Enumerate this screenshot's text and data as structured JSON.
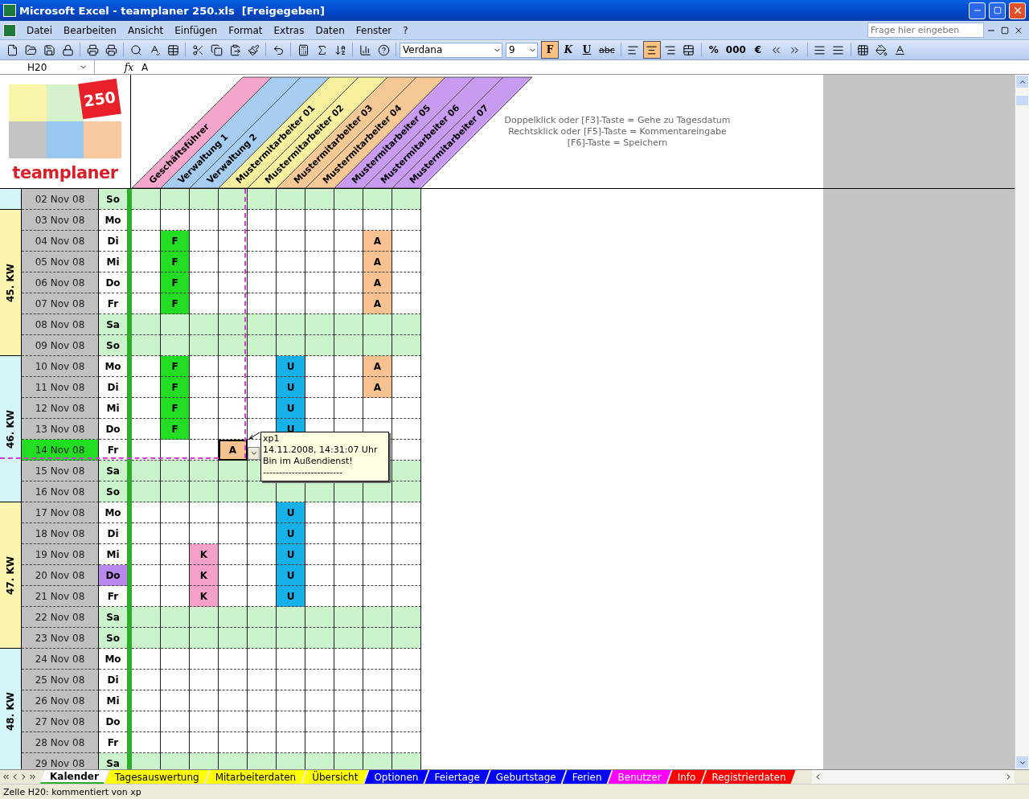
{
  "window": {
    "title": "Microsoft Excel - teamplaner 250.xls  [Freigegeben]"
  },
  "menu": [
    "Datei",
    "Bearbeiten",
    "Ansicht",
    "Einfügen",
    "Format",
    "Extras",
    "Daten",
    "Fenster",
    "?"
  ],
  "help_field": {
    "placeholder": "Frage hier eingeben"
  },
  "formatting": {
    "font": "Verdana",
    "size": "9",
    "styles": [
      {
        "label": "F",
        "kind": "bold",
        "pressed": true
      },
      {
        "label": "K",
        "kind": "italic",
        "pressed": false
      },
      {
        "label": "U",
        "kind": "underline",
        "pressed": false
      },
      {
        "label": "abc",
        "kind": "strike",
        "pressed": false
      }
    ],
    "alignment": [
      {
        "selected": false
      },
      {
        "selected": true
      },
      {
        "selected": false
      }
    ],
    "number_formats": [
      "%",
      "000",
      "€"
    ]
  },
  "formula_bar": {
    "name_box": "H20",
    "fx_label": "fx",
    "value": "A"
  },
  "logo": {
    "badge": "250",
    "name": "teamplaner"
  },
  "employees": [
    {
      "name": "Geschäftsführer",
      "color": "#f4a6cc"
    },
    {
      "name": "Verwaltung 1",
      "color": "#a6ccf0"
    },
    {
      "name": "Verwaltung 2",
      "color": "#a6ccf0"
    },
    {
      "name": "Mustermitarbeiter 01",
      "color": "#f8f2a0"
    },
    {
      "name": "Mustermitarbeiter 02",
      "color": "#f8f2a0"
    },
    {
      "name": "Mustermitarbeiter 03",
      "color": "#f6c896"
    },
    {
      "name": "Mustermitarbeiter 04",
      "color": "#f6c896"
    },
    {
      "name": "Mustermitarbeiter 05",
      "color": "#c89af0"
    },
    {
      "name": "Mustermitarbeiter 06",
      "color": "#c89af0"
    },
    {
      "name": "Mustermitarbeiter 07",
      "color": "#c89af0"
    }
  ],
  "instructions": [
    "Doppelklick oder [F3]-Taste = Gehe zu Tagesdatum",
    "Rechtsklick oder [F5]-Taste = Kommentareingabe",
    "[F6]-Taste = Speichern"
  ],
  "weeks": [
    {
      "color": "#d4f6f8",
      "days": [
        {
          "date": "02 Nov 08",
          "day": "So",
          "weekend": true,
          "today": false,
          "cells": [
            null,
            null,
            null,
            null,
            null,
            null,
            null,
            null,
            null,
            null
          ]
        }
      ]
    },
    {
      "label": "45. KW",
      "color": "#fcf6b0",
      "days": [
        {
          "date": "03 Nov 08",
          "day": "Mo",
          "weekend": false,
          "today": false,
          "cells": [
            null,
            null,
            null,
            null,
            null,
            null,
            null,
            null,
            null,
            null
          ]
        },
        {
          "date": "04 Nov 08",
          "day": "Di",
          "weekend": false,
          "today": false,
          "cells": [
            null,
            {
              "code": "F",
              "color": "#22dd22",
              "selected": false
            },
            null,
            null,
            null,
            null,
            null,
            null,
            {
              "code": "A",
              "color": "#f8c290",
              "selected": false
            },
            null
          ]
        },
        {
          "date": "05 Nov 08",
          "day": "Mi",
          "weekend": false,
          "today": false,
          "cells": [
            null,
            {
              "code": "F",
              "color": "#22dd22",
              "selected": false
            },
            null,
            null,
            null,
            null,
            null,
            null,
            {
              "code": "A",
              "color": "#f8c290",
              "selected": false
            },
            null
          ]
        },
        {
          "date": "06 Nov 08",
          "day": "Do",
          "weekend": false,
          "today": false,
          "cells": [
            null,
            {
              "code": "F",
              "color": "#22dd22",
              "selected": false
            },
            null,
            null,
            null,
            null,
            null,
            null,
            {
              "code": "A",
              "color": "#f8c290",
              "selected": false
            },
            null
          ]
        },
        {
          "date": "07 Nov 08",
          "day": "Fr",
          "weekend": false,
          "today": false,
          "cells": [
            null,
            {
              "code": "F",
              "color": "#22dd22",
              "selected": false
            },
            null,
            null,
            null,
            null,
            null,
            null,
            {
              "code": "A",
              "color": "#f8c290",
              "selected": false
            },
            null
          ]
        },
        {
          "date": "08 Nov 08",
          "day": "Sa",
          "weekend": true,
          "today": false,
          "cells": [
            null,
            null,
            null,
            null,
            null,
            null,
            null,
            null,
            null,
            null
          ]
        },
        {
          "date": "09 Nov 08",
          "day": "So",
          "weekend": true,
          "today": false,
          "cells": [
            null,
            null,
            null,
            null,
            null,
            null,
            null,
            null,
            null,
            null
          ]
        }
      ]
    },
    {
      "label": "46. KW",
      "color": "#d4f6f8",
      "days": [
        {
          "date": "10 Nov 08",
          "day": "Mo",
          "weekend": false,
          "today": false,
          "cells": [
            null,
            {
              "code": "F",
              "color": "#22dd22",
              "selected": false
            },
            null,
            null,
            null,
            {
              "code": "U",
              "color": "#18b0e8",
              "selected": false
            },
            null,
            null,
            {
              "code": "A",
              "color": "#f8c290",
              "selected": false
            },
            null
          ]
        },
        {
          "date": "11 Nov 08",
          "day": "Di",
          "weekend": false,
          "today": false,
          "cells": [
            null,
            {
              "code": "F",
              "color": "#22dd22",
              "selected": false
            },
            null,
            null,
            null,
            {
              "code": "U",
              "color": "#18b0e8",
              "selected": false
            },
            null,
            null,
            {
              "code": "A",
              "color": "#f8c290",
              "selected": false
            },
            null
          ]
        },
        {
          "date": "12 Nov 08",
          "day": "Mi",
          "weekend": false,
          "today": false,
          "cells": [
            null,
            {
              "code": "F",
              "color": "#22dd22",
              "selected": false
            },
            null,
            null,
            null,
            {
              "code": "U",
              "color": "#18b0e8",
              "selected": false
            },
            null,
            null,
            null,
            null
          ]
        },
        {
          "date": "13 Nov 08",
          "day": "Do",
          "weekend": false,
          "today": false,
          "cells": [
            null,
            {
              "code": "F",
              "color": "#22dd22",
              "selected": false
            },
            null,
            null,
            null,
            {
              "code": "U",
              "color": "#18b0e8",
              "selected": false
            },
            null,
            null,
            null,
            null
          ]
        },
        {
          "date": "14 Nov 08",
          "day": "Fr",
          "weekend": false,
          "today": true,
          "cells": [
            null,
            null,
            null,
            {
              "code": "A",
              "color": "#f8c290",
              "selected": true
            },
            null,
            null,
            null,
            null,
            null,
            null
          ]
        },
        {
          "date": "15 Nov 08",
          "day": "Sa",
          "weekend": true,
          "today": false,
          "cells": [
            null,
            null,
            null,
            null,
            null,
            null,
            null,
            null,
            null,
            null
          ]
        },
        {
          "date": "16 Nov 08",
          "day": "So",
          "weekend": true,
          "today": false,
          "cells": [
            null,
            null,
            null,
            null,
            null,
            null,
            null,
            null,
            null,
            null
          ]
        }
      ]
    },
    {
      "label": "47. KW",
      "color": "#fcf6b0",
      "days": [
        {
          "date": "17 Nov 08",
          "day": "Mo",
          "weekend": false,
          "today": false,
          "cells": [
            null,
            null,
            null,
            null,
            null,
            {
              "code": "U",
              "color": "#18b0e8",
              "selected": false
            },
            null,
            null,
            null,
            null
          ]
        },
        {
          "date": "18 Nov 08",
          "day": "Di",
          "weekend": false,
          "today": false,
          "cells": [
            null,
            null,
            null,
            null,
            null,
            {
              "code": "U",
              "color": "#18b0e8",
              "selected": false
            },
            null,
            null,
            null,
            null
          ]
        },
        {
          "date": "19 Nov 08",
          "day": "Mi",
          "weekend": false,
          "today": false,
          "cells": [
            null,
            null,
            {
              "code": "K",
              "color": "#f4a0c8",
              "selected": false
            },
            null,
            null,
            {
              "code": "U",
              "color": "#18b0e8",
              "selected": false
            },
            null,
            null,
            null,
            null
          ]
        },
        {
          "date": "20 Nov 08",
          "day": "Do",
          "color": "#b888ec",
          "weekend": false,
          "today": false,
          "cells": [
            null,
            null,
            {
              "code": "K",
              "color": "#f4a0c8",
              "selected": false
            },
            null,
            null,
            {
              "code": "U",
              "color": "#18b0e8",
              "selected": false
            },
            null,
            null,
            null,
            null
          ]
        },
        {
          "date": "21 Nov 08",
          "day": "Fr",
          "weekend": false,
          "today": false,
          "cells": [
            null,
            null,
            {
              "code": "K",
              "color": "#f4a0c8",
              "selected": false
            },
            null,
            null,
            {
              "code": "U",
              "color": "#18b0e8",
              "selected": false
            },
            null,
            null,
            null,
            null
          ]
        },
        {
          "date": "22 Nov 08",
          "day": "Sa",
          "weekend": true,
          "today": false,
          "cells": [
            null,
            null,
            null,
            null,
            null,
            null,
            null,
            null,
            null,
            null
          ]
        },
        {
          "date": "23 Nov 08",
          "day": "So",
          "weekend": true,
          "today": false,
          "cells": [
            null,
            null,
            null,
            null,
            null,
            null,
            null,
            null,
            null,
            null
          ]
        }
      ]
    },
    {
      "label": "48. KW",
      "color": "#d4f6f8",
      "days": [
        {
          "date": "24 Nov 08",
          "day": "Mo",
          "weekend": false,
          "today": false,
          "cells": [
            null,
            null,
            null,
            null,
            null,
            null,
            null,
            null,
            null,
            null
          ]
        },
        {
          "date": "25 Nov 08",
          "day": "Di",
          "weekend": false,
          "today": false,
          "cells": [
            null,
            null,
            null,
            null,
            null,
            null,
            null,
            null,
            null,
            null
          ]
        },
        {
          "date": "26 Nov 08",
          "day": "Mi",
          "weekend": false,
          "today": false,
          "cells": [
            null,
            null,
            null,
            null,
            null,
            null,
            null,
            null,
            null,
            null
          ]
        },
        {
          "date": "27 Nov 08",
          "day": "Do",
          "weekend": false,
          "today": false,
          "cells": [
            null,
            null,
            null,
            null,
            null,
            null,
            null,
            null,
            null,
            null
          ]
        },
        {
          "date": "28 Nov 08",
          "day": "Fr",
          "weekend": false,
          "today": false,
          "cells": [
            null,
            null,
            null,
            null,
            null,
            null,
            null,
            null,
            null,
            null
          ]
        },
        {
          "date": "29 Nov 08",
          "day": "Sa",
          "weekend": true,
          "today": false,
          "cells": [
            null,
            null,
            null,
            null,
            null,
            null,
            null,
            null,
            null,
            null
          ]
        }
      ]
    }
  ],
  "comment": {
    "lines": [
      "xp1",
      "14.11.2008, 14:31:07 Uhr",
      "Bin im Außendienst!",
      "-------------------------"
    ]
  },
  "sheet_tabs": [
    {
      "label": "Kalender",
      "selected": true,
      "color": "#ffffff"
    },
    {
      "label": "Tagesauswertung",
      "selected": false,
      "color": "#ffff00"
    },
    {
      "label": "Mitarbeiterdaten",
      "selected": false,
      "color": "#ffff00"
    },
    {
      "label": "Übersicht",
      "selected": false,
      "color": "#ffff00"
    },
    {
      "label": "Optionen",
      "selected": false,
      "color": "#0000ff"
    },
    {
      "label": "Feiertage",
      "selected": false,
      "color": "#0000ff"
    },
    {
      "label": "Geburtstage",
      "selected": false,
      "color": "#0000ff"
    },
    {
      "label": "Ferien",
      "selected": false,
      "color": "#0000ff"
    },
    {
      "label": "Benutzer",
      "selected": false,
      "color": "#ff00ff"
    },
    {
      "label": "Info",
      "selected": false,
      "color": "#ff0000"
    },
    {
      "label": "Registrierdaten",
      "selected": false,
      "color": "#ff0000"
    }
  ],
  "status": "Zelle H20: kommentiert von xp"
}
